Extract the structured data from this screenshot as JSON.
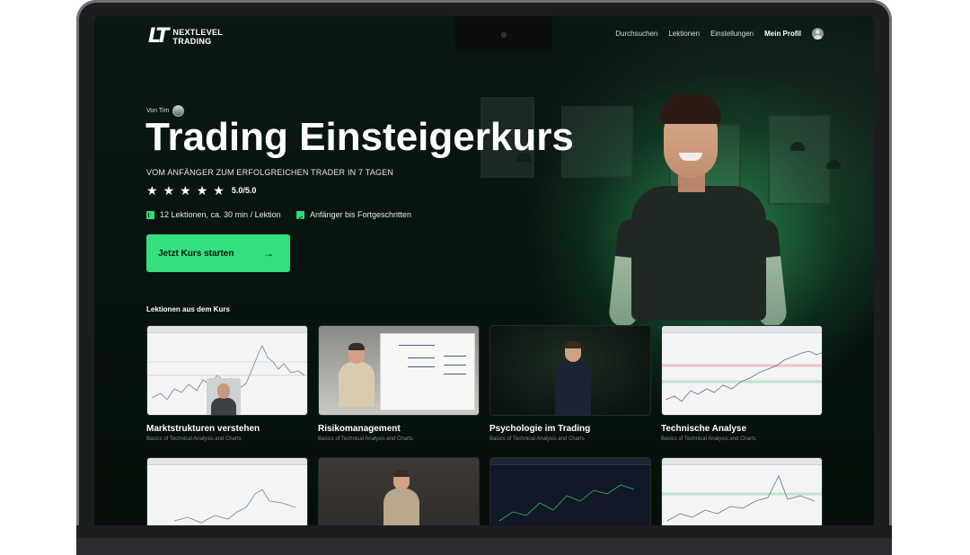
{
  "nav": {
    "logo_mark": "LT",
    "logo_line1": "NEXTLEVEL",
    "logo_line2": "TRADING",
    "links": [
      "Durchsuchen",
      "Lektionen",
      "Einstellungen"
    ],
    "profile": "Mein Profil"
  },
  "hero": {
    "by": "Von Tim",
    "title": "Trading Einsteigerkurs",
    "subtitle": "VOM ANFÄNGER ZUM ERFOLGREICHEN TRADER IN 7 TAGEN",
    "stars": 5,
    "rating": "5.0/5.0",
    "meta_lessons": "12 Lektionen, ca. 30 min / Lektion",
    "meta_level": "Anfänger bis Fortgeschritten",
    "cta": "Jetzt Kurs starten",
    "cta_arrow": "→"
  },
  "lessons": {
    "section_title": "Lektionen aus dem Kurs",
    "cards": [
      {
        "title": "Marktstrukturen verstehen",
        "subtitle": "Basics of Technical Analysis and Charts"
      },
      {
        "title": "Risikomanagement",
        "subtitle": "Basics of Technical Analysis and Charts"
      },
      {
        "title": "Psychologie im Trading",
        "subtitle": "Basics of Technical Analysis and Charts"
      },
      {
        "title": "Technische Analyse",
        "subtitle": "Basics of Technical Analysis and Charts"
      }
    ]
  },
  "colors": {
    "accent": "#34e07e",
    "background": "#07130f",
    "text": "#ffffff",
    "muted": "#7f8a85"
  },
  "icons": {
    "star": "★",
    "lessons_icon": "book-icon",
    "level_icon": "chart-icon",
    "profile_icon": "user-avatar-icon"
  }
}
